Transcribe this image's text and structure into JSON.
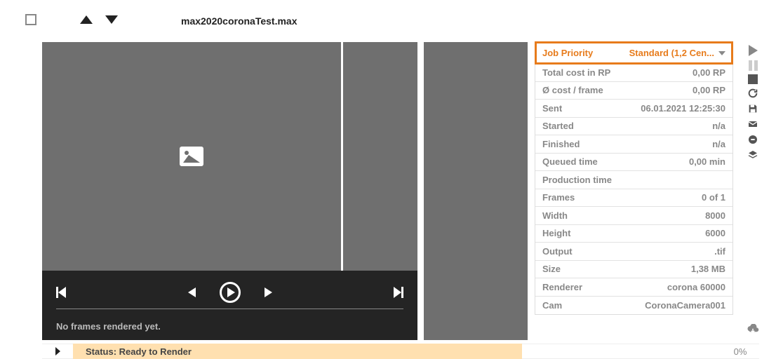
{
  "header": {
    "filename": "max2020coronaTest.max"
  },
  "preview": {
    "no_frames": "No frames rendered yet."
  },
  "props": {
    "job_priority": {
      "label": "Job Priority",
      "value": "Standard (1,2 Cen..."
    },
    "total_cost": {
      "label": "Total cost in RP",
      "value": "0,00 RP"
    },
    "avg_cost": {
      "label": "Ø cost / frame",
      "value": "0,00 RP"
    },
    "sent": {
      "label": "Sent",
      "value": "06.01.2021 12:25:30"
    },
    "started": {
      "label": "Started",
      "value": "n/a"
    },
    "finished": {
      "label": "Finished",
      "value": "n/a"
    },
    "queued": {
      "label": "Queued time",
      "value": "0,00 min"
    },
    "production": {
      "label": "Production time",
      "value": ""
    },
    "frames": {
      "label": "Frames",
      "value": "0 of 1"
    },
    "width": {
      "label": "Width",
      "value": "8000"
    },
    "height": {
      "label": "Height",
      "value": "6000"
    },
    "output": {
      "label": "Output",
      "value": ".tif"
    },
    "size": {
      "label": "Size",
      "value": "1,38 MB"
    },
    "renderer": {
      "label": "Renderer",
      "value": "corona 60000"
    },
    "cam": {
      "label": "Cam",
      "value": "CoronaCamera001"
    }
  },
  "status": {
    "text": "Status: Ready to Render",
    "pct": "0%"
  }
}
